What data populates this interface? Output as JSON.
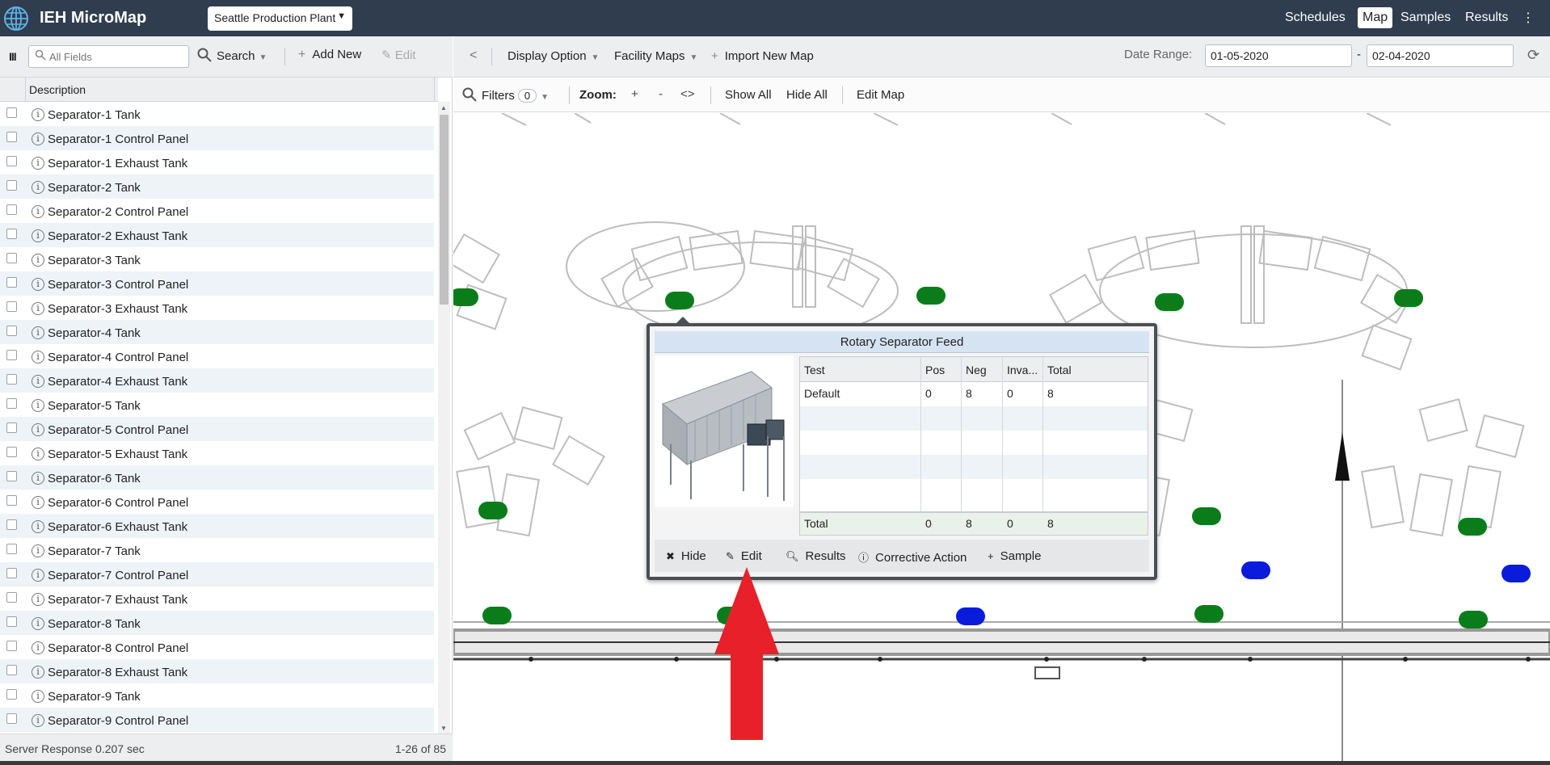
{
  "app": {
    "title": "IEH MicroMap",
    "plant": "Seattle Production Plant"
  },
  "nav": {
    "schedules": "Schedules",
    "map": "Map",
    "samples": "Samples",
    "results": "Results",
    "more": "⋮"
  },
  "left_toolbar": {
    "search_placeholder": "All Fields",
    "search_label": "Search",
    "add_new_label": "Add New",
    "edit_label": "Edit"
  },
  "list": {
    "column_header": "Description",
    "items": [
      "Separator-1 Tank",
      "Separator-1 Control Panel",
      "Separator-1 Exhaust Tank",
      "Separator-2 Tank",
      "Separator-2 Control Panel",
      "Separator-2 Exhaust Tank",
      "Separator-3 Tank",
      "Separator-3 Control Panel",
      "Separator-3 Exhaust Tank",
      "Separator-4 Tank",
      "Separator-4 Control Panel",
      "Separator-4 Exhaust Tank",
      "Separator-5 Tank",
      "Separator-5 Control Panel",
      "Separator-5 Exhaust Tank",
      "Separator-6 Tank",
      "Separator-6 Control Panel",
      "Separator-6 Exhaust Tank",
      "Separator-7 Tank",
      "Separator-7 Control Panel",
      "Separator-7 Exhaust Tank",
      "Separator-8 Tank",
      "Separator-8 Control Panel",
      "Separator-8 Exhaust Tank",
      "Separator-9 Tank",
      "Separator-9 Control Panel"
    ]
  },
  "status": {
    "server_response": "Server Response 0.207 sec",
    "page_count": "1-26 of 85"
  },
  "map_toolbar": {
    "display_option": "Display Option",
    "facility_maps": "Facility Maps",
    "import_new_map": "Import New Map",
    "date_range_label": "Date Range:",
    "date_from": "01-05-2020",
    "date_to": "02-04-2020",
    "date_separator": "-",
    "filters_label": "Filters",
    "filters_count": "0",
    "zoom_label": "Zoom:",
    "zoom_in": "+",
    "zoom_out": "-",
    "zoom_fit": "<>",
    "show_all": "Show All",
    "hide_all": "Hide All",
    "edit_map": "Edit Map"
  },
  "popup": {
    "title": "Rotary Separator Feed",
    "columns": [
      "Test",
      "Pos",
      "Neg",
      "Inva...",
      "Total"
    ],
    "rows": [
      [
        "Default",
        "0",
        "8",
        "0",
        "8"
      ]
    ],
    "total": [
      "Total",
      "0",
      "8",
      "0",
      "8"
    ],
    "actions": {
      "hide": "Hide",
      "edit": "Edit",
      "results": "Results",
      "corrective_action": "Corrective Action",
      "sample": "Sample"
    }
  },
  "colors": {
    "topbar": "#2f3d4f",
    "marker_green": "#0a7d1a",
    "marker_blue": "#0a1bdc",
    "annotation_red": "#e8202a"
  }
}
